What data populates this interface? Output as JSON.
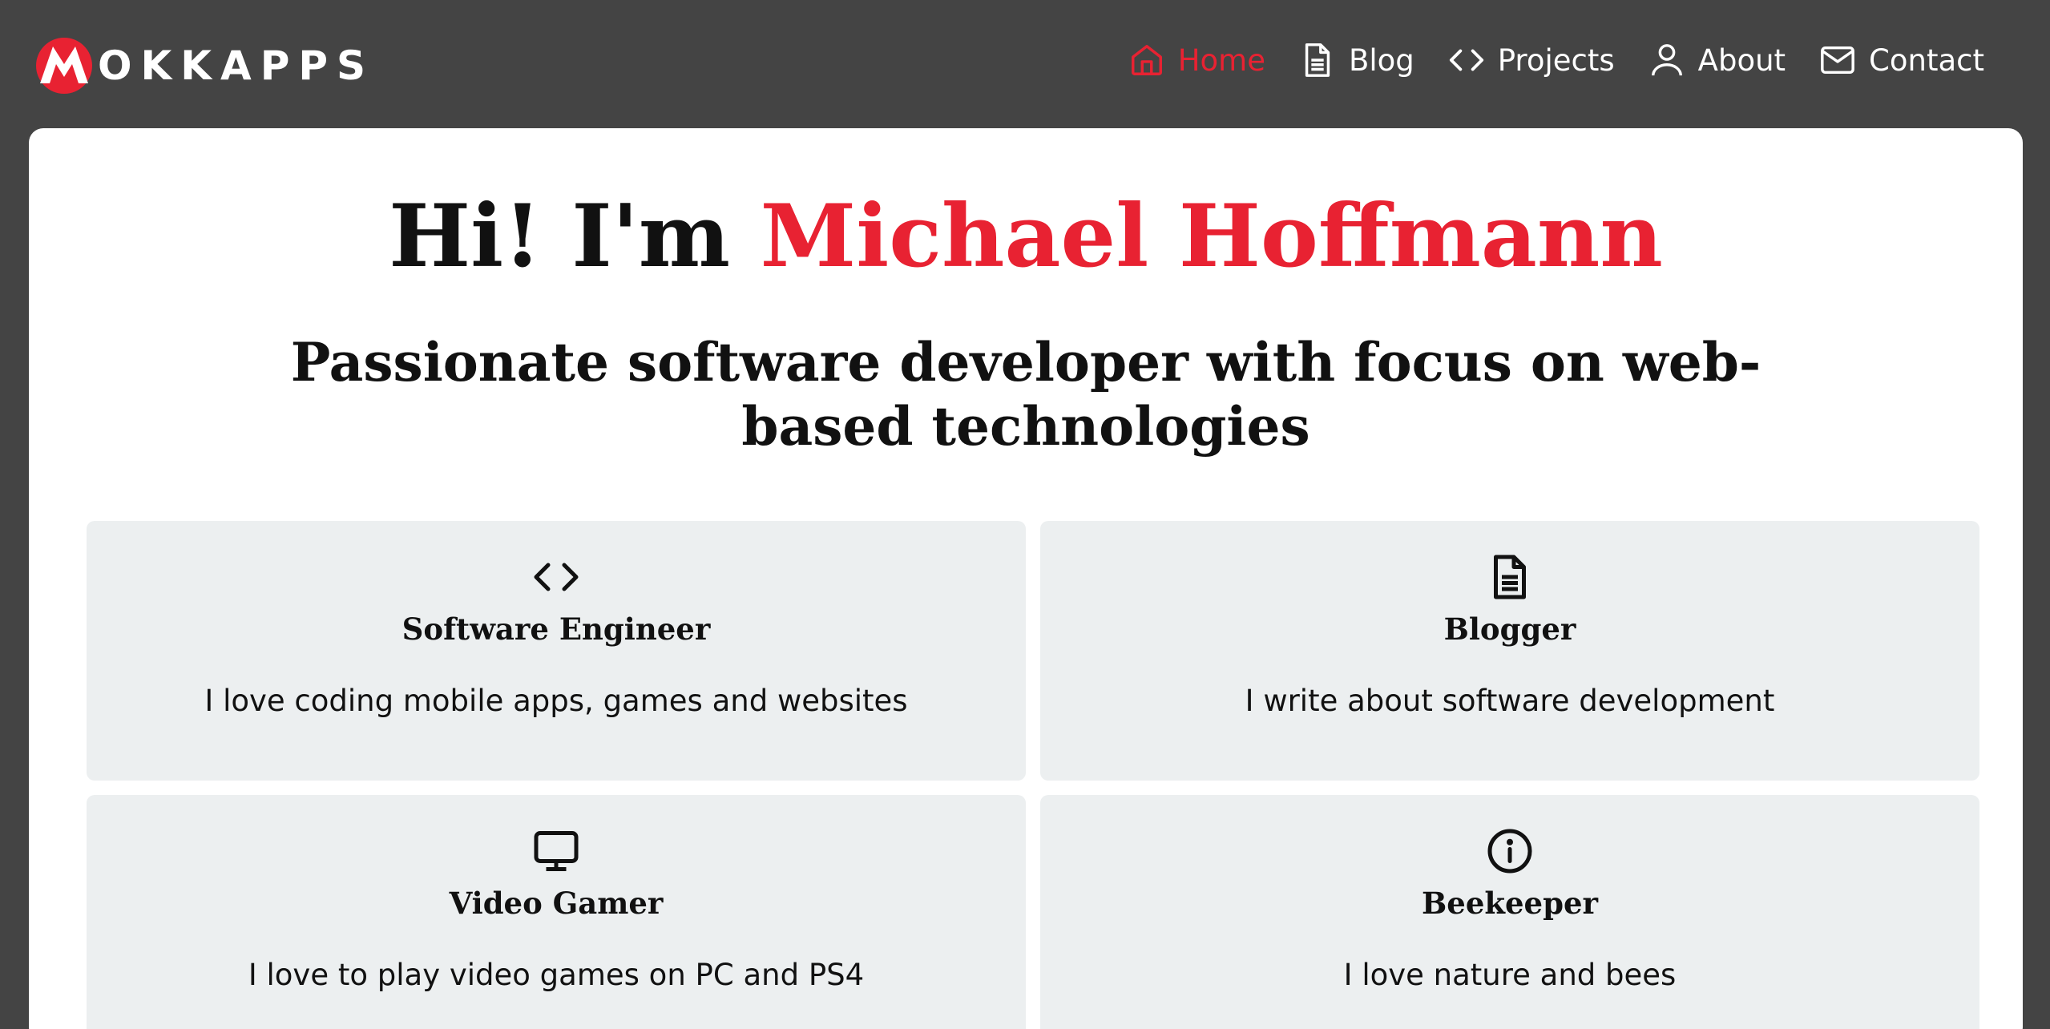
{
  "brand": {
    "name": "OKKAPPS",
    "accent_color": "#e82232"
  },
  "nav": {
    "items": [
      {
        "label": "Home",
        "icon": "home-icon",
        "active": true
      },
      {
        "label": "Blog",
        "icon": "document-icon",
        "active": false
      },
      {
        "label": "Projects",
        "icon": "code-icon",
        "active": false
      },
      {
        "label": "About",
        "icon": "user-icon",
        "active": false
      },
      {
        "label": "Contact",
        "icon": "mail-icon",
        "active": false
      }
    ]
  },
  "hero": {
    "greeting": "Hi! I'm",
    "name": "Michael Hoffmann",
    "subtitle": "Passionate software developer with focus on web-based technologies"
  },
  "tiles": [
    {
      "icon": "code-icon",
      "title": "Software Engineer",
      "description": "I love coding mobile apps, games and websites"
    },
    {
      "icon": "document-icon",
      "title": "Blogger",
      "description": "I write about software development"
    },
    {
      "icon": "monitor-icon",
      "title": "Video Gamer",
      "description": "I love to play video games on PC and PS4"
    },
    {
      "icon": "info-icon",
      "title": "Beekeeper",
      "description": "I love nature and bees"
    }
  ]
}
